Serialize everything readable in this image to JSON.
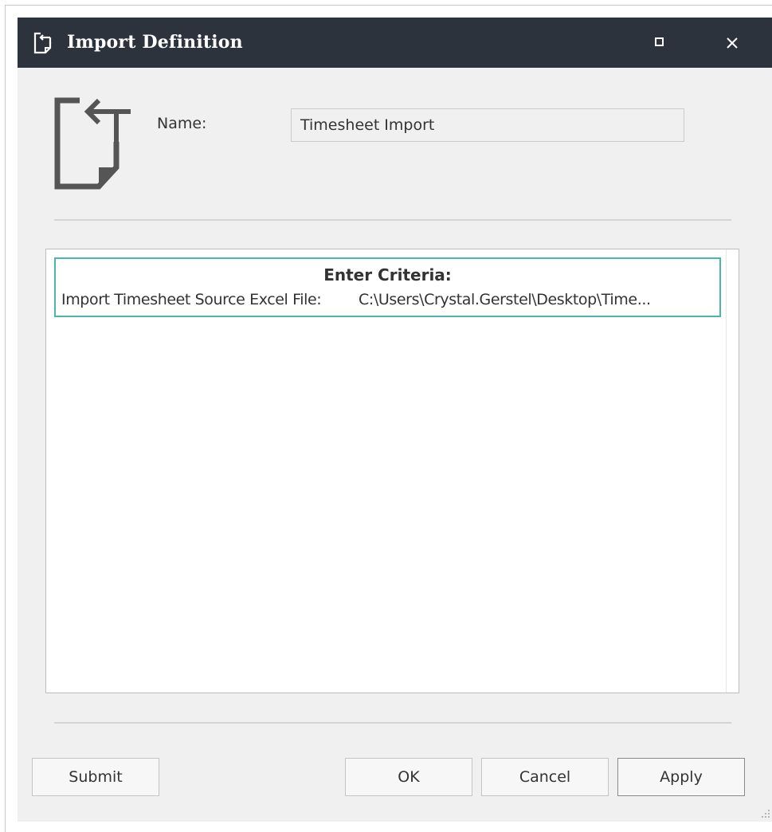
{
  "window": {
    "title": "Import Definition",
    "title_icon": "import-document-icon",
    "controls": [
      "maximize-icon",
      "close-icon"
    ]
  },
  "header": {
    "icon": "import-document-icon",
    "name_label": "Name:",
    "name_value": "Timesheet Import"
  },
  "criteria": {
    "heading": "Enter Criteria:",
    "rows": [
      {
        "label": "Import Timesheet Source Excel File:",
        "value": "C:\\Users\\Crystal.Gerstel\\Desktop\\Time..."
      }
    ],
    "accent_color": "#4db6ac"
  },
  "buttons": {
    "submit": "Submit",
    "ok": "OK",
    "cancel": "Cancel",
    "apply": "Apply"
  },
  "colors": {
    "titlebar": "#2d333d",
    "dialog_bg": "#f0f0f0"
  }
}
